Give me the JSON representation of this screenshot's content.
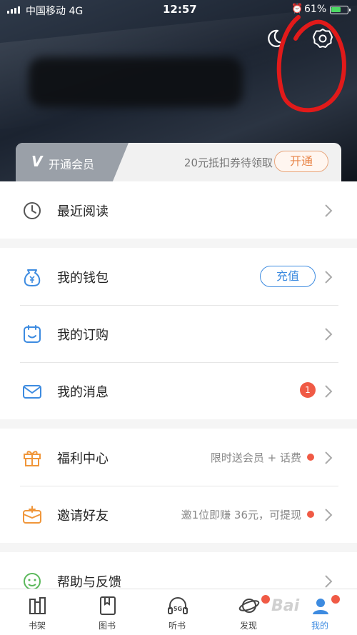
{
  "status_bar": {
    "carrier": "中国移动  4G",
    "time": "12:57",
    "battery": "61%"
  },
  "vip": {
    "logo": "V",
    "label": "开通会员",
    "promo": "20元抵扣券待领取",
    "button": "开通"
  },
  "menu": {
    "recent_reading": "最近阅读",
    "wallet": "我的钱包",
    "recharge": "充值",
    "subscriptions": "我的订购",
    "messages": "我的消息",
    "message_count": "1",
    "welfare": "福利中心",
    "welfare_promo": "限时送会员 + 话费",
    "invite": "邀请好友",
    "invite_promo": "邀1位即赚 36元，可提现",
    "help": "帮助与反馈"
  },
  "tabs": [
    "书架",
    "图书",
    "听书",
    "发现",
    "我的"
  ],
  "watermark": "Bai"
}
